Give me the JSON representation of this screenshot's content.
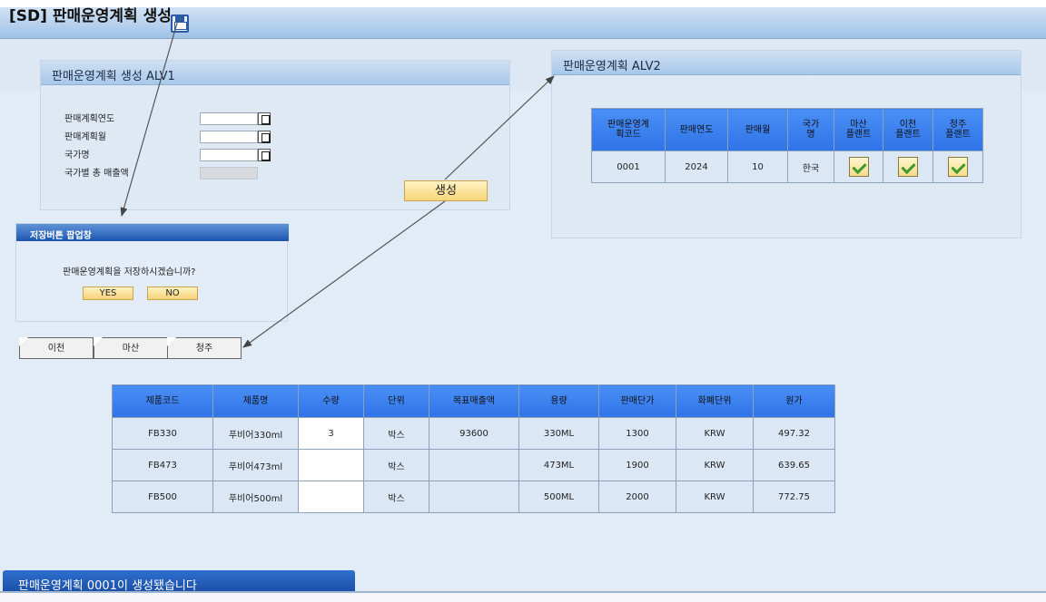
{
  "app": {
    "title": "[SD] 판매운영계획 생성"
  },
  "alv1": {
    "title": "판매운영계획 생성 ALV1",
    "fields": [
      {
        "label": "판매계획연도",
        "value": ""
      },
      {
        "label": "판매계획월",
        "value": ""
      },
      {
        "label": "국가명",
        "value": ""
      },
      {
        "label": "국가별 총 매출액",
        "value": ""
      }
    ],
    "create_button": "생성"
  },
  "alv2": {
    "title": "판매운영계획 ALV2",
    "headers": [
      "판매운영계\n획코드",
      "판매연도",
      "판매월",
      "국가\n명",
      "마산\n플랜트",
      "이천\n플랜트",
      "청주\n플랜트"
    ],
    "row": {
      "code": "0001",
      "year": "2024",
      "month": "10",
      "country": "한국",
      "masan": true,
      "icheon": true,
      "cheongju": true
    }
  },
  "popup": {
    "title": "저장버튼 팝업창",
    "message": "판매운영계획을 저장하시겠습니까?",
    "yes": "YES",
    "no": "NO"
  },
  "tabs": [
    "이천",
    "마산",
    "청주"
  ],
  "product_table": {
    "headers": [
      "제품코드",
      "제품명",
      "수량",
      "단위",
      "목표매출액",
      "용량",
      "판매단가",
      "화폐단위",
      "원가"
    ],
    "rows": [
      [
        "FB330",
        "푸비어330ml",
        "3",
        "박스",
        "93600",
        "330ML",
        "1300",
        "KRW",
        "497.32"
      ],
      [
        "FB473",
        "푸비어473ml",
        "",
        "박스",
        "",
        "473ML",
        "1900",
        "KRW",
        "639.65"
      ],
      [
        "FB500",
        "푸비어500ml",
        "",
        "박스",
        "",
        "500ML",
        "2000",
        "KRW",
        "772.75"
      ]
    ]
  },
  "status": {
    "message": "판매운영계획 0001이 생성됐습니다"
  },
  "colors": {
    "header_blue": "#3b82f6",
    "title_bar": "#a8c8ea",
    "button_yellow": "#f8d67a",
    "status_bar": "#1b4fa6"
  }
}
